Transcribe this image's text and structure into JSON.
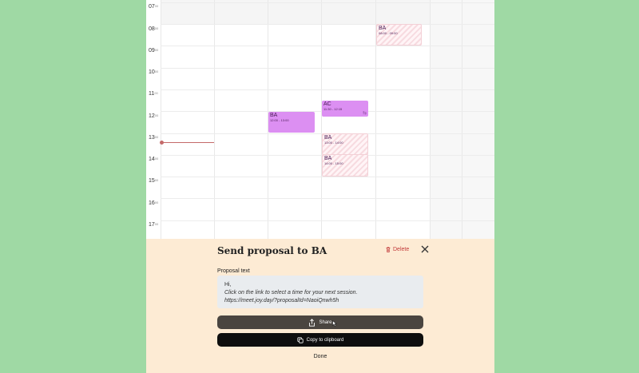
{
  "calendar": {
    "hours": [
      {
        "label": "07",
        "suffix": "00"
      },
      {
        "label": "08",
        "suffix": "00"
      },
      {
        "label": "09",
        "suffix": "00"
      },
      {
        "label": "10",
        "suffix": "00"
      },
      {
        "label": "11",
        "suffix": "00"
      },
      {
        "label": "12",
        "suffix": "00"
      },
      {
        "label": "13",
        "suffix": "00"
      },
      {
        "label": "14",
        "suffix": "00"
      },
      {
        "label": "15",
        "suffix": "00"
      },
      {
        "label": "16",
        "suffix": "00"
      },
      {
        "label": "17",
        "suffix": "00"
      }
    ],
    "events": [
      {
        "title": "BA",
        "time": "08:00 - 09:00",
        "style": "hatched"
      },
      {
        "title": "AC",
        "time": "11:30 - 12:15",
        "style": "solid"
      },
      {
        "title": "BA",
        "time": "12:00 - 13:00",
        "style": "solid"
      },
      {
        "title": "BA",
        "time": "13:00 - 14:00",
        "style": "hatched"
      },
      {
        "title": "BA",
        "time": "14:00 - 15:00",
        "style": "hatched"
      }
    ],
    "now_indicator_color": "#c46a6a"
  },
  "panel": {
    "title": "Send proposal to BA",
    "delete_label": "Delete",
    "proposal_label": "Proposal text",
    "proposal_text": {
      "line1": "Hi,",
      "line2": "Click on the link to select a time for your next session.",
      "line3": "https://meet.joy.day/?proposalId=NaoiQnwh5h"
    },
    "share_label": "Share",
    "copy_label": "Copy to clipboard",
    "done_label": "Done"
  },
  "colors": {
    "background": "#9fd9a4",
    "panel": "#fdebd4",
    "event_solid": "#dc8ff2",
    "delete": "#c23a3a"
  }
}
